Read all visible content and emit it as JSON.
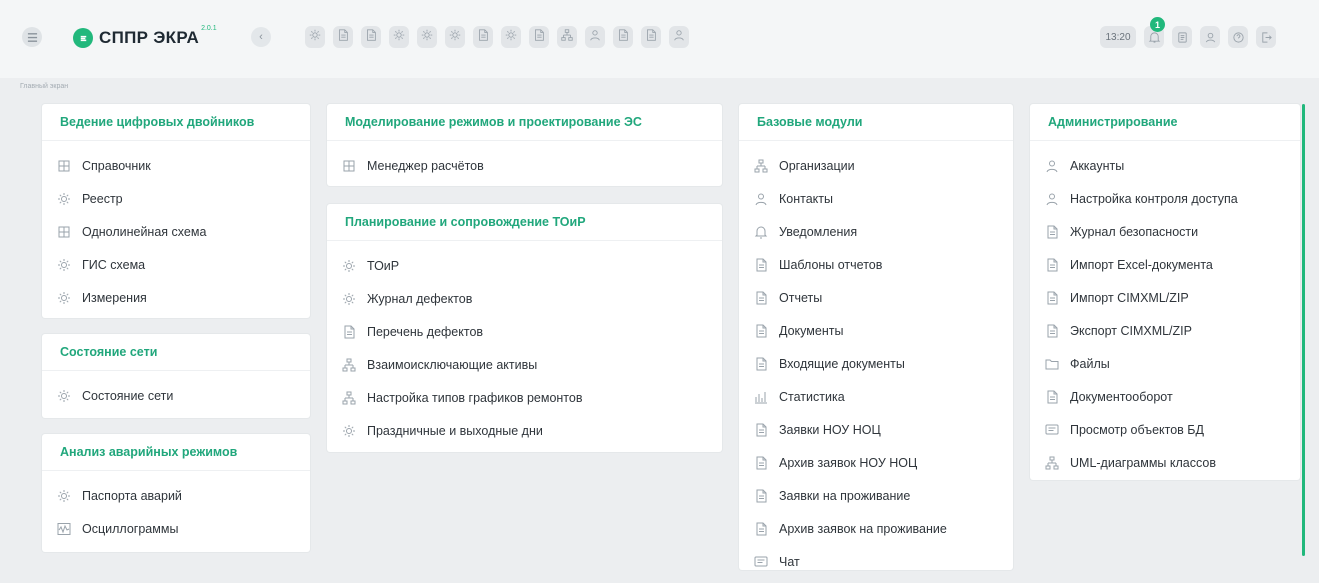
{
  "header": {
    "app_name": "СППР ЭКРА",
    "version": "2.0.1",
    "time": "13:20",
    "notifications_count": "1",
    "quick_icons": [
      "registry-icon",
      "document-icon",
      "scheme-icon",
      "gis-icon",
      "measurement-icon",
      "accident-icon",
      "report-icon",
      "toir-icon",
      "defect-icon",
      "organization-icon",
      "contacts-icon",
      "file-icon",
      "template-icon",
      "accounts-icon"
    ],
    "right_icons": [
      "bell-icon",
      "notes-icon",
      "user-icon",
      "help-icon",
      "logout-icon"
    ]
  },
  "breadcrumb": "Главный экран",
  "colors": {
    "accent": "#21a77c",
    "brand": "#21b87c",
    "background": "#eceef0",
    "card": "#ffffff",
    "icon": "#9aa3ab"
  },
  "cards": {
    "digital_twins": {
      "title": "Ведение цифровых двойников",
      "items": [
        {
          "label": "Справочник",
          "icon": "directory-icon"
        },
        {
          "label": "Реестр",
          "icon": "registry-icon"
        },
        {
          "label": "Однолинейная схема",
          "icon": "single-line-diagram-icon"
        },
        {
          "label": "ГИС схема",
          "icon": "gis-scheme-icon"
        },
        {
          "label": "Измерения",
          "icon": "measurements-icon"
        }
      ]
    },
    "network_state": {
      "title": "Состояние сети",
      "items": [
        {
          "label": "Состояние сети",
          "icon": "network-state-icon"
        }
      ]
    },
    "emergency": {
      "title": "Анализ аварийных режимов",
      "items": [
        {
          "label": "Паспорта аварий",
          "icon": "accident-passport-icon"
        },
        {
          "label": "Осциллограммы",
          "icon": "oscillogram-icon"
        }
      ]
    },
    "modeling": {
      "title": "Моделирование режимов и проектирование ЭС",
      "items": [
        {
          "label": "Менеджер расчётов",
          "icon": "calc-manager-icon"
        }
      ]
    },
    "planning": {
      "title": "Планирование и сопровождение ТОиР",
      "items": [
        {
          "label": "ТОиР",
          "icon": "toir-icon"
        },
        {
          "label": "Журнал дефектов",
          "icon": "defect-journal-icon"
        },
        {
          "label": "Перечень дефектов",
          "icon": "defect-list-icon"
        },
        {
          "label": "Взаимоисключающие активы",
          "icon": "exclusive-assets-icon"
        },
        {
          "label": "Настройка типов графиков ремонтов",
          "icon": "repair-schedule-icon"
        },
        {
          "label": "Праздничные и выходные дни",
          "icon": "holidays-icon"
        }
      ]
    },
    "base_modules": {
      "title": "Базовые модули",
      "items": [
        {
          "label": "Организации",
          "icon": "organizations-icon"
        },
        {
          "label": "Контакты",
          "icon": "contacts-icon"
        },
        {
          "label": "Уведомления",
          "icon": "notifications-icon"
        },
        {
          "label": "Шаблоны отчетов",
          "icon": "report-templates-icon"
        },
        {
          "label": "Отчеты",
          "icon": "reports-icon"
        },
        {
          "label": "Документы",
          "icon": "documents-icon"
        },
        {
          "label": "Входящие документы",
          "icon": "incoming-docs-icon"
        },
        {
          "label": "Статистика",
          "icon": "statistics-icon"
        },
        {
          "label": "Заявки НОУ НОЦ",
          "icon": "requests-icon"
        },
        {
          "label": "Архив заявок НОУ НОЦ",
          "icon": "requests-archive-icon"
        },
        {
          "label": "Заявки на проживание",
          "icon": "accommodation-icon"
        },
        {
          "label": "Архив заявок на проживание",
          "icon": "accommodation-archive-icon"
        },
        {
          "label": "Чат",
          "icon": "chat-icon"
        }
      ]
    },
    "administration": {
      "title": "Администрирование",
      "items": [
        {
          "label": "Аккаунты",
          "icon": "accounts-icon"
        },
        {
          "label": "Настройка контроля доступа",
          "icon": "access-control-icon"
        },
        {
          "label": "Журнал безопасности",
          "icon": "security-log-icon"
        },
        {
          "label": "Импорт Excel-документа",
          "icon": "import-excel-icon"
        },
        {
          "label": "Импорт CIMXML/ZIP",
          "icon": "import-cimxml-icon"
        },
        {
          "label": "Экспорт CIMXML/ZIP",
          "icon": "export-cimxml-icon"
        },
        {
          "label": "Файлы",
          "icon": "files-icon"
        },
        {
          "label": "Документооборот",
          "icon": "workflow-icon"
        },
        {
          "label": "Просмотр объектов БД",
          "icon": "db-objects-icon"
        },
        {
          "label": "UML-диаграммы классов",
          "icon": "uml-icon"
        }
      ]
    }
  }
}
